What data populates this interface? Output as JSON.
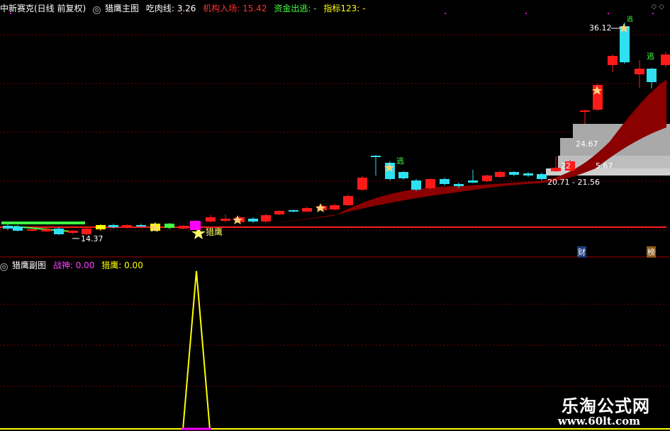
{
  "header": {
    "stock": "中新赛克(日线 前复权)",
    "indicator_name": "猎鹰主图",
    "line1_label": "吃肉线: ",
    "line1_value": "3.26",
    "line2_label": "机构入场: ",
    "line2_value": "15.42",
    "line3_label": "资金出逃: ",
    "line3_value": "-",
    "line4_label": "指标123: ",
    "line4_value": "-"
  },
  "sub": {
    "indicator_name": "猎鹰副图",
    "s1_label": "战神: ",
    "s1_value": "0.00",
    "s2_label": "猎鹰: ",
    "s2_value": "0.00"
  },
  "labels": {
    "high": "36.12",
    "low": "14.37",
    "chip1": "24.67",
    "chip2": "22",
    "chip3": "5.67",
    "chip4": "20.71 - 21.56",
    "hunt": "猎鹰",
    "escape1": "逃",
    "escape2": "逃",
    "escape3": "逃",
    "tag_cai": "财",
    "tag_bang": "榜"
  },
  "watermark": {
    "title": "乐淘公式网",
    "url": "www.60lt.com"
  },
  "colors": {
    "up": "#ff1a1a",
    "down": "#2fe0f0",
    "ribbon": "#8b0000",
    "grid": "#7a0000",
    "sub_line": "#ffff00",
    "magenta": "#ff00ff",
    "green": "#40ff40",
    "yellow": "#ffff00"
  }
}
